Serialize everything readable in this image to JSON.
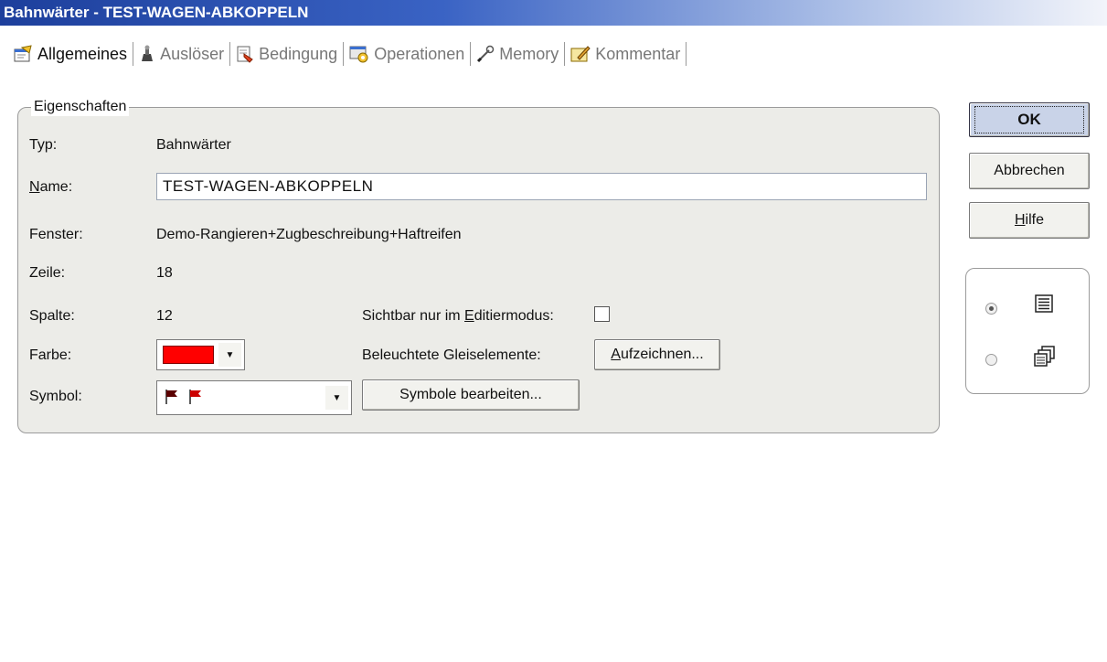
{
  "window": {
    "title": "Bahnwärter - TEST-WAGEN-ABKOPPELN"
  },
  "tabs": [
    {
      "label": "Allgemeines",
      "icon": "properties-icon",
      "active": true
    },
    {
      "label": "Auslöser",
      "icon": "trigger-icon",
      "active": false
    },
    {
      "label": "Bedingung",
      "icon": "condition-icon",
      "active": false
    },
    {
      "label": "Operationen",
      "icon": "operations-icon",
      "active": false
    },
    {
      "label": "Memory",
      "icon": "memory-icon",
      "active": false
    },
    {
      "label": "Kommentar",
      "icon": "comment-icon",
      "active": false
    }
  ],
  "properties": {
    "group_title": "Eigenschaften",
    "typ_label": "Typ:",
    "typ_value": "Bahnwärter",
    "name_label": "Name:",
    "name_value": "TEST-WAGEN-ABKOPPELN",
    "fenster_label": "Fenster:",
    "fenster_value": "Demo-Rangieren+Zugbeschreibung+Haftreifen",
    "zeile_label": "Zeile:",
    "zeile_value": "18",
    "spalte_label": "Spalte:",
    "spalte_value": "12",
    "sichtbar_label": "Sichtbar nur im Editiermodus:",
    "sichtbar_checked": false,
    "farbe_label": "Farbe:",
    "farbe_color": "#ff0000",
    "beleuchtete_label": "Beleuchtete Gleiselemente:",
    "aufzeichnen_label": "Aufzeichnen...",
    "symbol_label": "Symbol:",
    "symbole_bearbeiten_label": "Symbole bearbeiten..."
  },
  "buttons": {
    "ok_label": "OK",
    "cancel_label": "Abbrechen",
    "help_label": "Hilfe"
  },
  "view_mode": {
    "options": [
      {
        "icon": "list-view-icon",
        "checked": true
      },
      {
        "icon": "cascade-view-icon",
        "checked": false
      }
    ]
  },
  "colors": {
    "title_bar": "#1d3f9c",
    "group_background": "#ecece8",
    "flag": "#cc0000"
  }
}
